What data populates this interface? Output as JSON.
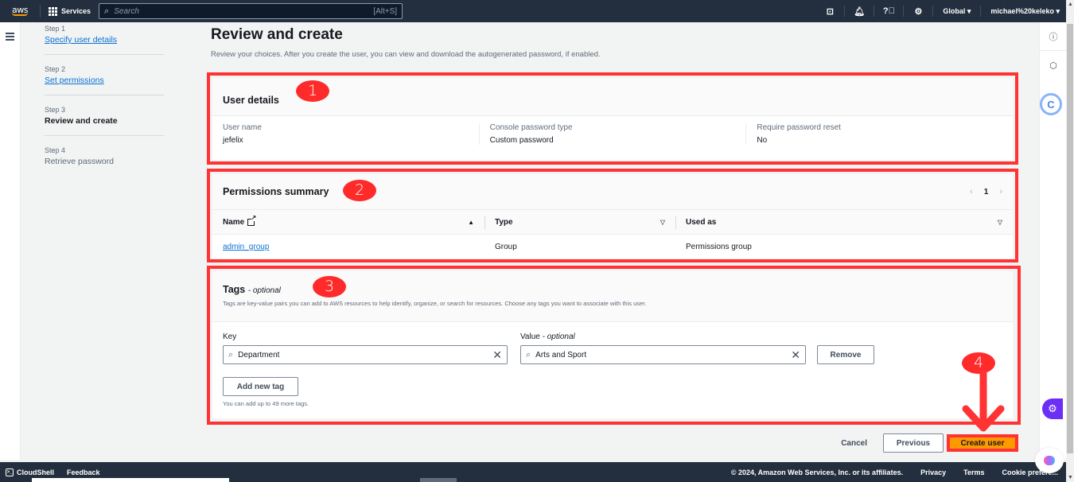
{
  "topnav": {
    "logo": "aws",
    "services_label": "Services",
    "search_placeholder": "Search",
    "search_shortcut": "[Alt+S]",
    "icons": [
      "cloudshell-icon",
      "bell-icon",
      "help-icon",
      "settings-icon"
    ],
    "region": "Global ▾",
    "account": "michael%20keleko ▾"
  },
  "steps": [
    {
      "num": "Step 1",
      "label": "Specify user details",
      "state": "link"
    },
    {
      "num": "Step 2",
      "label": "Set permissions",
      "state": "link"
    },
    {
      "num": "Step 3",
      "label": "Review and create",
      "state": "current"
    },
    {
      "num": "Step 4",
      "label": "Retrieve password",
      "state": "disabled"
    }
  ],
  "header": {
    "title": "Review and create",
    "description": "Review your choices. After you create the user, you can view and download the autogenerated password, if enabled."
  },
  "user_details": {
    "title": "User details",
    "fields": [
      {
        "label": "User name",
        "value": "jefelix"
      },
      {
        "label": "Console password type",
        "value": "Custom password"
      },
      {
        "label": "Require password reset",
        "value": "No"
      }
    ]
  },
  "permissions": {
    "title": "Permissions summary",
    "page": "1",
    "columns": [
      {
        "label": "Name",
        "sort": "▲"
      },
      {
        "label": "Type",
        "sort": "▽"
      },
      {
        "label": "Used as",
        "sort": "▽"
      }
    ],
    "rows": [
      {
        "name": "admin_group",
        "type": "Group",
        "used_as": "Permissions group"
      }
    ]
  },
  "tags": {
    "title": "Tags",
    "optional": "- optional",
    "description": "Tags are key-value pairs you can add to AWS resources to help identify, organize, or search for resources. Choose any tags you want to associate with this user.",
    "key_label": "Key",
    "value_label": "Value",
    "value_optional": "- optional",
    "key_value": "Department",
    "value_value": "Arts and Sport",
    "remove_label": "Remove",
    "add_label": "Add new tag",
    "hint": "You can add up to 49 more tags."
  },
  "actions": {
    "cancel": "Cancel",
    "previous": "Previous",
    "create": "Create user"
  },
  "annotations": [
    "1",
    "2",
    "3",
    "4"
  ],
  "annotation_color": "#ff3333",
  "footer": {
    "cloudshell": "CloudShell",
    "feedback": "Feedback",
    "copyright": "© 2024, Amazon Web Services, Inc. or its affiliates.",
    "privacy": "Privacy",
    "terms": "Terms",
    "cookies": "Cookie prefere..."
  },
  "colors": {
    "nav_bg": "#232f3e",
    "link": "#0972d3",
    "primary_button": "#ff9900"
  }
}
